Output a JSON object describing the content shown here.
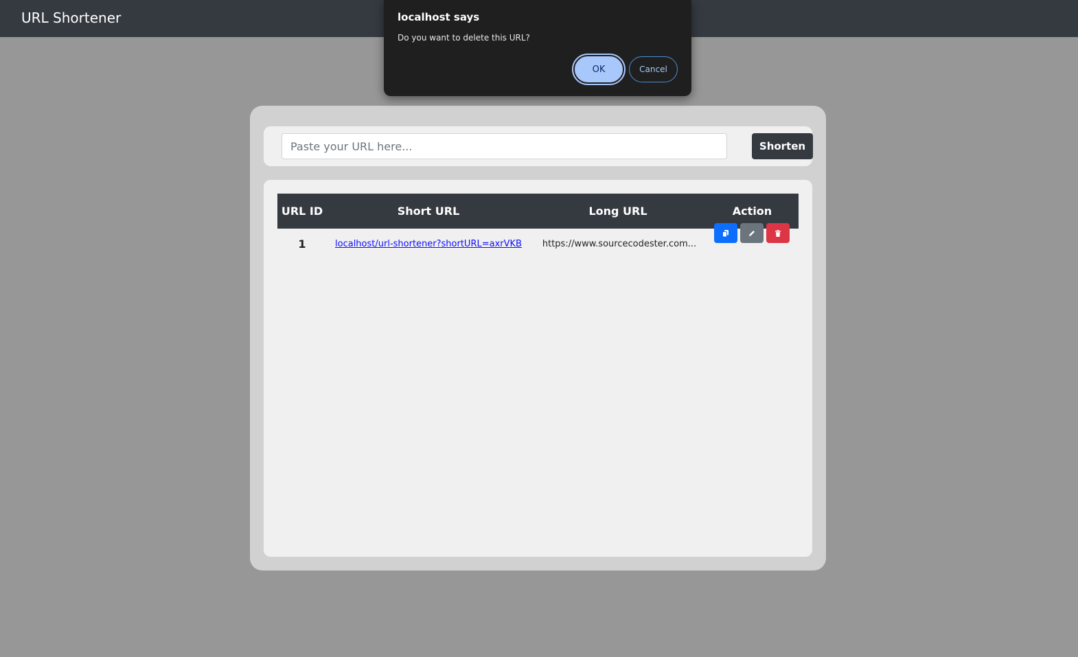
{
  "navbar": {
    "brand": "URL Shortener"
  },
  "form": {
    "placeholder": "Paste your URL here...",
    "button_label": "Shorten"
  },
  "table": {
    "headers": [
      "URL ID",
      "Short URL",
      "Long URL",
      "Action"
    ],
    "rows": [
      {
        "id": "1",
        "short_url": "localhost/url-shortener?shortURL=axrVKB",
        "long_url": "https://www.sourcecodester.com..."
      }
    ]
  },
  "actions": {
    "copy_icon": "copy-icon",
    "edit_icon": "pencil-icon",
    "delete_icon": "trash-icon"
  },
  "dialog": {
    "title": "localhost says",
    "message": "Do you want to delete this URL?",
    "ok_label": "OK",
    "cancel_label": "Cancel"
  },
  "colors": {
    "navbar": "#353a41",
    "copy": "#0b6efd",
    "edit": "#6c757d",
    "delete": "#dc3545",
    "dialog_accent": "#a8c7fa"
  }
}
